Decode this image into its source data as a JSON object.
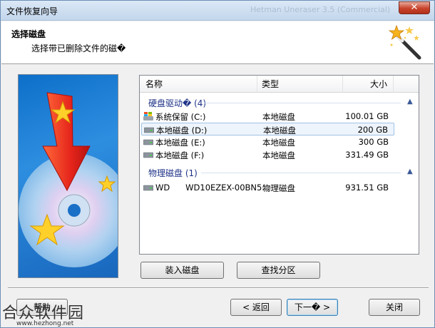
{
  "window": {
    "title": "文件恢复向导",
    "background_title": "Hetman Uneraser 3.5 (Commercial)"
  },
  "header": {
    "title": "选择磁盘",
    "subtitle": "选择带已删除文件的磁�"
  },
  "columns": {
    "name": "名称",
    "type": "类型",
    "size": "大小"
  },
  "groups": [
    {
      "label": "硬盘驱动� (4)",
      "rows": [
        {
          "name": "系统保留 (C:)",
          "type": "本地磁盘",
          "size": "100.01 GB",
          "icon": "windows-drive-icon",
          "selected": false
        },
        {
          "name": "本地磁盘 (D:)",
          "type": "本地磁盘",
          "size": "200 GB",
          "icon": "drive-icon",
          "selected": true
        },
        {
          "name": "本地磁盘 (E:)",
          "type": "本地磁盘",
          "size": "300 GB",
          "icon": "drive-icon",
          "selected": false
        },
        {
          "name": "本地磁盘 (F:)",
          "type": "本地磁盘",
          "size": "331.49 GB",
          "icon": "drive-icon",
          "selected": false
        }
      ]
    },
    {
      "label": "物理磁盘 (1)",
      "rows": [
        {
          "name": "WD      WD10EZEX-00BN5...",
          "type": "物理磁盘",
          "size": "931.51 GB",
          "icon": "drive-icon",
          "selected": false
        }
      ]
    }
  ],
  "buttons": {
    "mount": "装入磁盘",
    "find_partition": "查找分区",
    "help": "帮助",
    "back": "< 返回",
    "next": "下一� >",
    "close": "关闭"
  },
  "watermark": {
    "text": "合众软件园",
    "url": "www.hezhong.net"
  },
  "colors": {
    "accent": "#3c7fb1",
    "group_text": "#1e3287",
    "selection": "#eef4fb"
  }
}
